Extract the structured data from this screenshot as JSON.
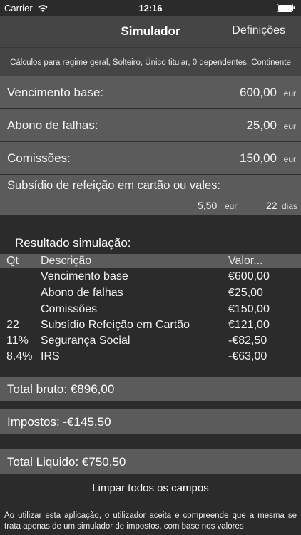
{
  "status": {
    "carrier": "Carrier",
    "time": "12:16"
  },
  "nav": {
    "title": "Simulador",
    "settings": "Definições"
  },
  "header": {
    "text": "Cálculos para regime geral, Solteiro, Único titular, 0 dependentes, Continente"
  },
  "fields": [
    {
      "label": "Vencimento base:",
      "value": "600,00",
      "unit": "eur"
    },
    {
      "label": "Abono de falhas:",
      "value": "25,00",
      "unit": "eur"
    },
    {
      "label": "Comissões:",
      "value": "150,00",
      "unit": "eur"
    }
  ],
  "meal": {
    "label": "Subsídio de refeição em cartão ou vales:",
    "value": "5,50",
    "value_unit": "eur",
    "days": "22",
    "days_unit": "dias"
  },
  "result": {
    "title": "Resultado simulação:",
    "columns": {
      "qt": "Qt",
      "desc": "Descrição",
      "val": "Valor..."
    },
    "rows": [
      {
        "qt": "",
        "desc": "Vencimento base",
        "val": "€600,00"
      },
      {
        "qt": "",
        "desc": "Abono de falhas",
        "val": "€25,00"
      },
      {
        "qt": "",
        "desc": "Comissões",
        "val": "€150,00"
      },
      {
        "qt": "22",
        "desc": "Subsídio Refeição em Cartão",
        "val": "€121,00"
      },
      {
        "qt": "11%",
        "desc": "Segurança Social",
        "val": "-€82,50"
      },
      {
        "qt": "8.4%",
        "desc": "IRS",
        "val": "-€63,00"
      }
    ]
  },
  "totals": {
    "bruto": "Total bruto: €896,00",
    "impostos": "Impostos: -€145,50",
    "liquido": "Total Liquido: €750,50"
  },
  "clear_label": "Limpar todos os campos",
  "disclaimer": "Ao utilizar esta aplicação, o utilizador aceita e compreende que a mesma se trata apenas de um simulador de impostos, com base nos valores"
}
